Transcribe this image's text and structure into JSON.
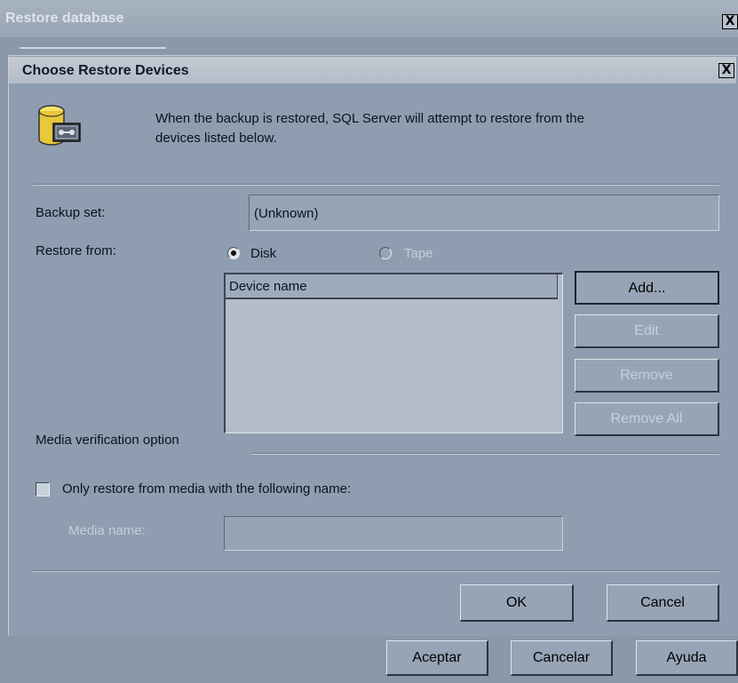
{
  "outer_window": {
    "title": "Restore database",
    "close_glyph": "X",
    "buttons": {
      "accept": "Aceptar",
      "cancel": "Cancelar",
      "help": "Ayuda"
    }
  },
  "dialog": {
    "title": "Choose Restore Devices",
    "close_glyph": "X",
    "icon": "database-backup-icon",
    "description_line1": "When the backup is restored, SQL Server will attempt to restore from the",
    "description_line2": "devices listed below.",
    "backup_set": {
      "label": "Backup set:",
      "value": "(Unknown)"
    },
    "restore_from": {
      "label": "Restore from:",
      "options": [
        {
          "label": "Disk",
          "selected": true,
          "enabled": true
        },
        {
          "label": "Tape",
          "selected": false,
          "enabled": false
        }
      ]
    },
    "device_list": {
      "column_header": "Device name",
      "items": []
    },
    "device_buttons": {
      "add": "Add...",
      "edit": "Edit",
      "remove": "Remove",
      "remove_all": "Remove All"
    },
    "media_verification": {
      "section_label": "Media verification option",
      "checkbox_label": "Only restore from media with the following name:",
      "checked": false,
      "media_name_label": "Media name:",
      "media_name_value": ""
    },
    "ok_label": "OK",
    "cancel_label": "Cancel"
  }
}
